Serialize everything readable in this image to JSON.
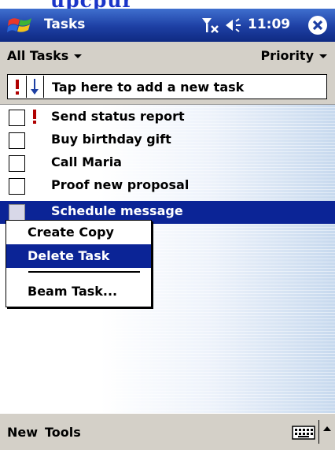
{
  "top_strip": {
    "text": "upcpur"
  },
  "titlebar": {
    "title": "Tasks",
    "time": "11:09"
  },
  "filterbar": {
    "category_label": "All Tasks",
    "sort_label": "Priority"
  },
  "entrybar": {
    "new_task_text": "Tap here to add a new task"
  },
  "tasks": [
    {
      "label": "Send status report",
      "checked": false,
      "high_priority": true,
      "selected": false
    },
    {
      "label": "Buy birthday gift",
      "checked": false,
      "high_priority": false,
      "selected": false
    },
    {
      "label": "Call Maria",
      "checked": false,
      "high_priority": false,
      "selected": false
    },
    {
      "label": "Proof new proposal",
      "checked": false,
      "high_priority": false,
      "selected": false
    },
    {
      "label": "Schedule message",
      "checked": false,
      "high_priority": false,
      "selected": true
    }
  ],
  "context_menu": {
    "items": [
      {
        "label": "Create Copy",
        "highlighted": false
      },
      {
        "label": "Delete Task",
        "highlighted": true
      },
      {
        "label": "Beam Task...",
        "highlighted": false
      }
    ]
  },
  "menubar": {
    "new_label": "New",
    "tools_label": "Tools"
  },
  "colors": {
    "title_bar": "#1d3fa3",
    "selection": "#0b2496",
    "priority_red": "#b00000",
    "chrome_gray": "#d4d0c8"
  },
  "icons": {
    "start": "windows-flag-icon",
    "signal": "antenna-off-icon",
    "volume": "speaker-icon",
    "close": "close-circle-icon",
    "priority": "exclamation-icon",
    "sort": "down-arrow-icon",
    "keyboard": "keyboard-icon",
    "sip": "chevron-up-icon"
  }
}
